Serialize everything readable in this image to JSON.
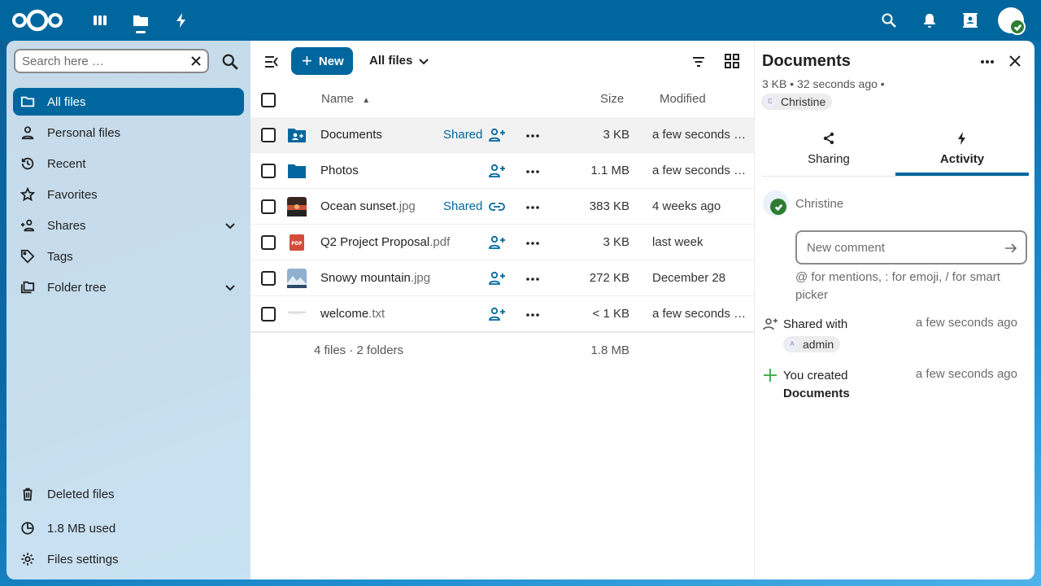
{
  "colors": {
    "primary": "#00679e",
    "success": "#2e7d32",
    "accent_green": "#4caf50"
  },
  "topbar": {
    "icons": [
      "nextcloud-logo",
      "dashboard-icon",
      "files-icon",
      "activity-icon",
      "search-icon",
      "notifications-icon",
      "contacts-icon",
      "avatar"
    ]
  },
  "sidebar": {
    "search_placeholder": "Search here …",
    "items": [
      {
        "label": "All files",
        "icon": "folder-icon",
        "active": true
      },
      {
        "label": "Personal files",
        "icon": "person-icon"
      },
      {
        "label": "Recent",
        "icon": "history-icon"
      },
      {
        "label": "Favorites",
        "icon": "star-icon"
      },
      {
        "label": "Shares",
        "icon": "share-icon",
        "expandable": true
      },
      {
        "label": "Tags",
        "icon": "tag-icon"
      },
      {
        "label": "Folder tree",
        "icon": "folder-tree-icon",
        "expandable": true
      }
    ],
    "bottom": {
      "deleted": "Deleted files",
      "quota": "1.8 MB used",
      "settings": "Files settings"
    }
  },
  "toolbar": {
    "new_label": "New",
    "breadcrumb": "All files"
  },
  "table": {
    "headers": {
      "name": "Name",
      "size": "Size",
      "modified": "Modified"
    },
    "rows": [
      {
        "name": "Documents",
        "ext": "",
        "type": "shared-folder",
        "shared_label": "Shared",
        "share_icon": "add-person",
        "size": "3 KB",
        "modified": "a few seconds ago",
        "selected": true
      },
      {
        "name": "Photos",
        "ext": "",
        "type": "folder",
        "shared_label": "",
        "share_icon": "add-person",
        "size": "1.1 MB",
        "modified": "a few seconds ago"
      },
      {
        "name": "Ocean sunset",
        "ext": ".jpg",
        "type": "image-sunset",
        "shared_label": "Shared",
        "share_icon": "link",
        "size": "383 KB",
        "modified": "4 weeks ago"
      },
      {
        "name": "Q2 Project Proposal",
        "ext": ".pdf",
        "type": "pdf",
        "shared_label": "",
        "share_icon": "add-person",
        "size": "3 KB",
        "modified": "last week"
      },
      {
        "name": "Snowy mountain",
        "ext": ".jpg",
        "type": "image-mountain",
        "shared_label": "",
        "share_icon": "add-person",
        "size": "272 KB",
        "modified": "December 28"
      },
      {
        "name": "welcome",
        "ext": ".txt",
        "type": "text",
        "shared_label": "",
        "share_icon": "add-person",
        "size": "< 1 KB",
        "modified": "a few seconds ago"
      }
    ],
    "summary": {
      "counts": "4 files · 2 folders",
      "total": "1.8 MB"
    }
  },
  "details": {
    "title": "Documents",
    "subtitle": "3 KB  • 32 seconds ago  •",
    "owner": "Christine",
    "owner_initial": "C",
    "tabs": [
      {
        "label": "Sharing",
        "icon": "share-icon"
      },
      {
        "label": "Activity",
        "icon": "activity-icon",
        "active": true
      }
    ],
    "comment_user": "Christine",
    "comment_placeholder": "New comment",
    "comment_hint": "@ for mentions, : for emoji, / for smart picker",
    "events": [
      {
        "text": "Shared with",
        "chip": "admin",
        "chip_initial": "A",
        "when": "a few seconds ago",
        "icon": "add-person-icon"
      },
      {
        "text": "You created",
        "bold": "Documents",
        "when": "a few seconds ago",
        "icon": "plus-icon"
      }
    ]
  }
}
